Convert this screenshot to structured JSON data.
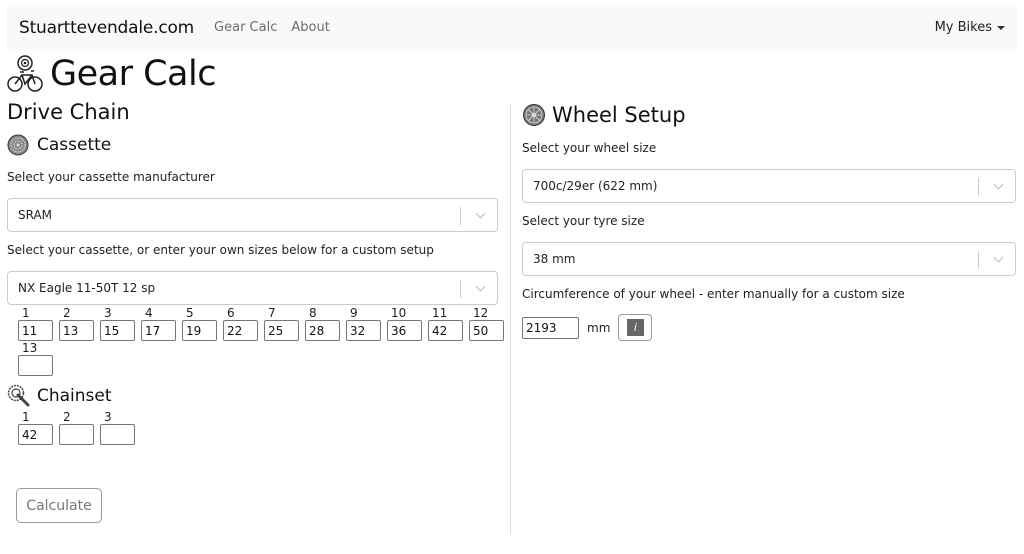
{
  "navbar": {
    "brand": "Stuarttevendale.com",
    "links": [
      "Gear Calc",
      "About"
    ],
    "my_bikes": "My Bikes"
  },
  "page": {
    "title": "Gear Calc",
    "icon": "bike-cog-icon"
  },
  "drive_chain": {
    "heading": "Drive Chain",
    "cassette": {
      "heading": "Cassette",
      "icon": "cassette-icon",
      "manufacturer_label": "Select your cassette manufacturer",
      "manufacturer_value": "SRAM",
      "cassette_label": "Select your cassette, or enter your own sizes below for a custom setup",
      "cassette_value": "NX Eagle 11-50T 12 sp",
      "sprockets": [
        {
          "index": "1",
          "value": "11"
        },
        {
          "index": "2",
          "value": "13"
        },
        {
          "index": "3",
          "value": "15"
        },
        {
          "index": "4",
          "value": "17"
        },
        {
          "index": "5",
          "value": "19"
        },
        {
          "index": "6",
          "value": "22"
        },
        {
          "index": "7",
          "value": "25"
        },
        {
          "index": "8",
          "value": "28"
        },
        {
          "index": "9",
          "value": "32"
        },
        {
          "index": "10",
          "value": "36"
        },
        {
          "index": "11",
          "value": "42"
        },
        {
          "index": "12",
          "value": "50"
        },
        {
          "index": "13",
          "value": ""
        }
      ]
    },
    "chainset": {
      "heading": "Chainset",
      "icon": "chainset-icon",
      "rings": [
        {
          "index": "1",
          "value": "42"
        },
        {
          "index": "2",
          "value": ""
        },
        {
          "index": "3",
          "value": ""
        }
      ]
    },
    "calculate_label": "Calculate"
  },
  "wheel_setup": {
    "heading": "Wheel Setup",
    "icon": "wheel-icon",
    "wheel_label": "Select your wheel size",
    "wheel_value": "700c/29er (622 mm)",
    "tyre_label": "Select your tyre size",
    "tyre_value": "38 mm",
    "circ_label": "Circumference of your wheel - enter manually for a custom size",
    "circ_value": "2193",
    "circ_unit": "mm",
    "info_icon": "i"
  }
}
